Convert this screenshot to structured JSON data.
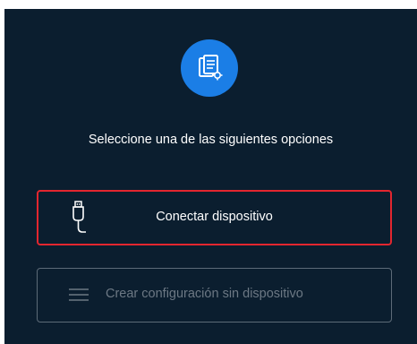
{
  "app_icon": "document-settings-icon",
  "instructions": "Seleccione una de las siguientes opciones",
  "options": [
    {
      "label": "Conectar dispositivo",
      "icon": "usb-cable-icon",
      "state": "highlighted"
    },
    {
      "label": "Crear configuración sin dispositivo",
      "icon": "menu-lines-icon",
      "state": "disabled"
    }
  ],
  "colors": {
    "background": "#0b1e2f",
    "accent": "#1b7ee6",
    "highlight_border": "#e3262f",
    "disabled_text": "#6c7884"
  }
}
